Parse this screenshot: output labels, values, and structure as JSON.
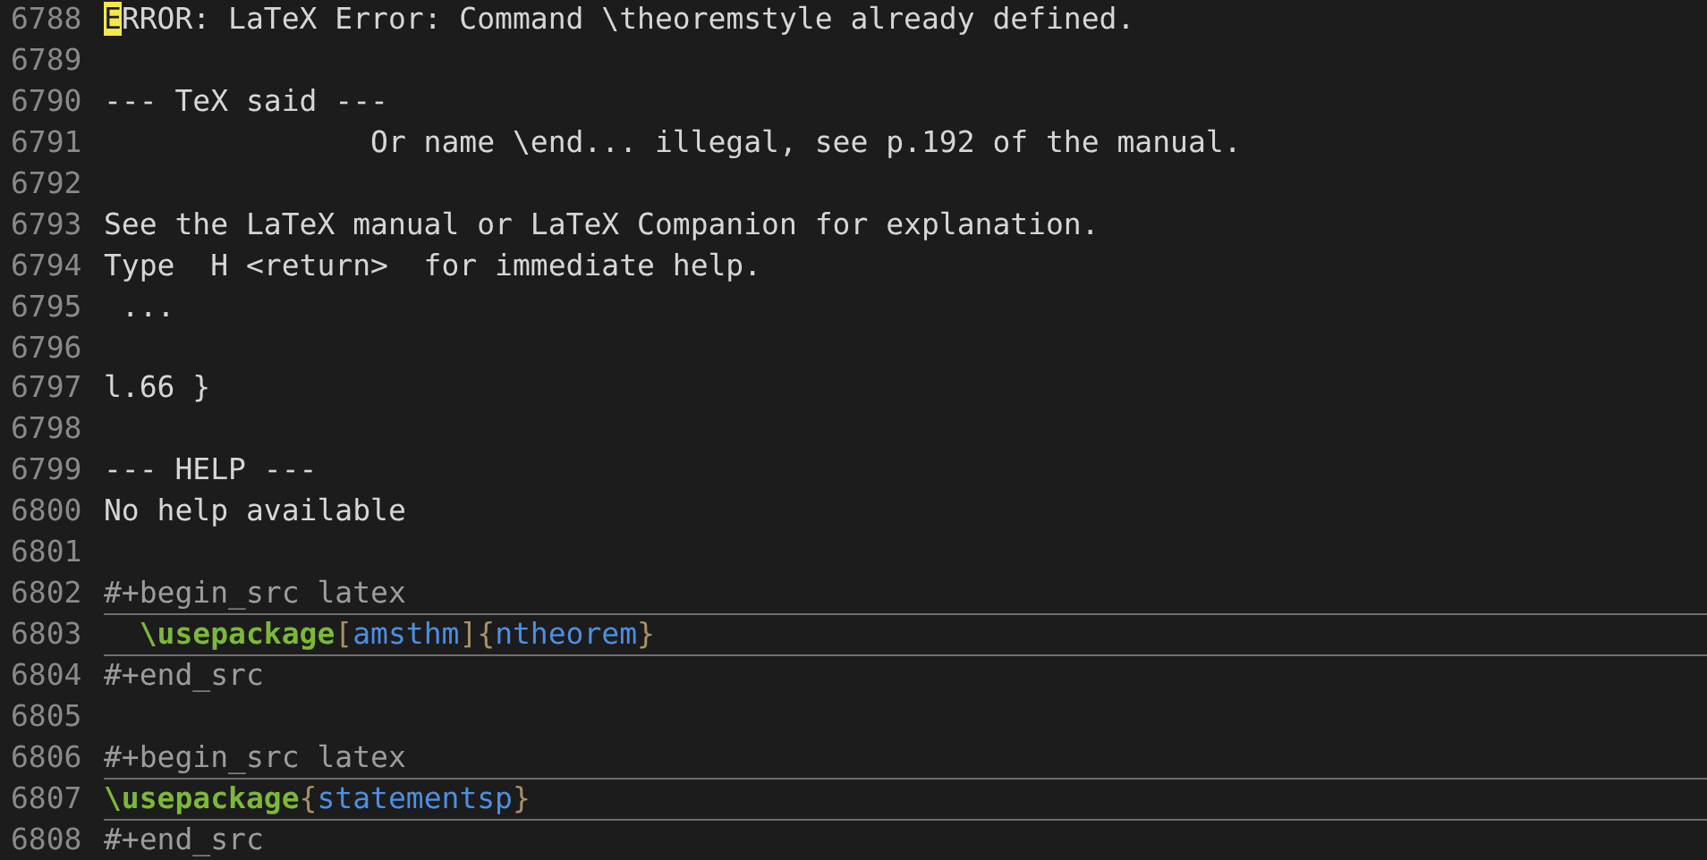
{
  "lines": [
    {
      "number": "6788",
      "kind": "text",
      "segments": [
        {
          "text": "E",
          "kind": "cursor"
        },
        {
          "text": "RROR: LaTeX Error: Command \\theoremstyle already defined.",
          "kind": "plain"
        }
      ]
    },
    {
      "number": "6789",
      "kind": "text"
    },
    {
      "number": "6790",
      "kind": "text",
      "segments": [
        {
          "text": "--- TeX said ---",
          "kind": "plain"
        }
      ]
    },
    {
      "number": "6791",
      "kind": "text",
      "segments": [
        {
          "text": "               Or name \\end... illegal, see p.192 of the manual.",
          "kind": "plain"
        }
      ]
    },
    {
      "number": "6792",
      "kind": "text"
    },
    {
      "number": "6793",
      "kind": "text",
      "segments": [
        {
          "text": "See the LaTeX manual or LaTeX Companion for explanation.",
          "kind": "plain"
        }
      ]
    },
    {
      "number": "6794",
      "kind": "text",
      "segments": [
        {
          "text": "Type  H <return>  for immediate help.",
          "kind": "plain"
        }
      ]
    },
    {
      "number": "6795",
      "kind": "text",
      "segments": [
        {
          "text": " ...",
          "kind": "plain"
        }
      ]
    },
    {
      "number": "6796",
      "kind": "text"
    },
    {
      "number": "6797",
      "kind": "text",
      "segments": [
        {
          "text": "l.66 }",
          "kind": "plain"
        }
      ]
    },
    {
      "number": "6798",
      "kind": "text"
    },
    {
      "number": "6799",
      "kind": "text",
      "segments": [
        {
          "text": "--- HELP ---",
          "kind": "plain"
        }
      ]
    },
    {
      "number": "6800",
      "kind": "text",
      "segments": [
        {
          "text": "No help available",
          "kind": "plain"
        }
      ]
    },
    {
      "number": "6801",
      "kind": "text"
    },
    {
      "number": "6802",
      "kind": "src-begin",
      "segments": [
        {
          "text": "#+begin_src latex",
          "kind": "meta"
        }
      ]
    },
    {
      "number": "6803",
      "kind": "src-body",
      "segments": [
        {
          "text": "  \\usepackage",
          "kind": "keyword"
        },
        {
          "text": "[",
          "kind": "bracket"
        },
        {
          "text": "amsthm",
          "kind": "arg"
        },
        {
          "text": "]{",
          "kind": "bracket"
        },
        {
          "text": "ntheorem",
          "kind": "arg"
        },
        {
          "text": "}",
          "kind": "bracket"
        }
      ]
    },
    {
      "number": "6804",
      "kind": "src-end",
      "segments": [
        {
          "text": "#+end_src",
          "kind": "meta"
        }
      ]
    },
    {
      "number": "6805",
      "kind": "text"
    },
    {
      "number": "6806",
      "kind": "src-begin",
      "segments": [
        {
          "text": "#+begin_src latex",
          "kind": "meta"
        }
      ]
    },
    {
      "number": "6807",
      "kind": "src-body",
      "segments": [
        {
          "text": "\\usepackage",
          "kind": "keyword"
        },
        {
          "text": "{",
          "kind": "bracket"
        },
        {
          "text": "statementsp",
          "kind": "arg"
        },
        {
          "text": "}",
          "kind": "bracket"
        }
      ]
    },
    {
      "number": "6808",
      "kind": "src-end",
      "segments": [
        {
          "text": "#+end_src",
          "kind": "meta"
        }
      ]
    }
  ]
}
